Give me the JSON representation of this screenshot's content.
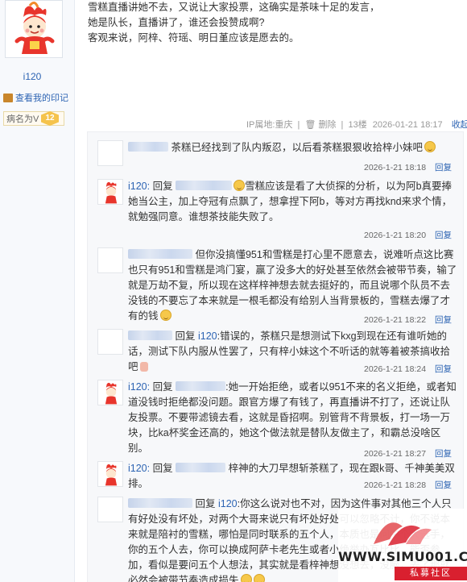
{
  "author": {
    "username": "i120",
    "imprint_link": "查看我的印记",
    "rank_title": "病名为V",
    "rank_level": "12"
  },
  "post": {
    "lines": [
      "雪糕直播讲她不去，又说让大家投票，这确实是茶味十足的发言，",
      "她是队长，直播讲了，谁还会投赞成啊?",
      "客观来说，阿梓、符瑶、明日堇应该是愿去的。"
    ],
    "ip": "IP属地:重庆",
    "delete": "删除",
    "floor": "13楼",
    "time": "2026-01-21 18:17",
    "reply_toggle": "收起回复"
  },
  "replies": [
    {
      "author_shown": "",
      "text": "茶糕已经找到了队内叛忍，以后看茶糕狠狠收拾梓小妹吧",
      "time": "2026-1-21 18:18",
      "reply_label": "回复"
    },
    {
      "author_shown": "i120:",
      "reply_prefix": "回复",
      "text": "雪糕应该是看了大侦探的分析，以为阿b真要捧她当公主，加上夺冠有点飘了，想拿捏下阿b，等对方再找knd来求个情，就勉强同意。谁想茶技能失败了。",
      "time": "2026-1-21 18:20",
      "reply_label": "回复"
    },
    {
      "author_shown": "",
      "text": "但你没搞懂951和雪糕是打心里不愿意去，说难听点这比赛也只有951和雪糕是鸿门宴，赢了没多大的好处甚至依然会被带节奏，输了就是万劫不复，所以现在这样梓神想去就去挺好的，而且说哪个队员不去没钱的不要忘了本来就是一根毛都没有给别人当背景板的，雪糕去爆了才有的钱",
      "time": "2026-1-21 18:22",
      "reply_label": "回复"
    },
    {
      "author_shown": "",
      "reply_prefix": "回复",
      "reply_target": "i120",
      "text": ":错误的，茶糕只是想测试下kxg到现在还有谁听她的话，测试下队内服从性罢了，只有梓小妹这个不听话的就等着被茶搞收拾吧",
      "time": "2026-1-21 18:24",
      "reply_label": "回复"
    },
    {
      "author_shown": "i120:",
      "reply_prefix": "回复",
      "text": ":她一开始拒绝，或者以951不来的名义拒绝，或者知道没钱时拒绝都没问题。跟官方爆了有钱了，再直播讲不打了，还说让队友投票。不要带滤镜去看，这就是昏招啊。别管背不背景板，打一场一万块，比ka杯奖金还高的，她这个做法就是替队友做主了，和霸总没啥区别。",
      "time": "2026-1-21 18:27",
      "reply_label": "回复"
    },
    {
      "author_shown": "i120:",
      "reply_prefix": "回复",
      "text": "梓神的大刀早想斩茶糕了，现在跟k哥、千神美美双排。",
      "time": "2026-1-21 18:28",
      "reply_label": "回复"
    },
    {
      "author_shown": "",
      "reply_prefix": "回复",
      "reply_target": "i120",
      "text": ":你这么说对也不对，因为这件事对其他三个人只有好处没有坏处，对两个大哥来说只有坏处好处可以忽略不计，你不说本来就是陪衬的雪糕，哪怕是同时联系的五个人，本质也是问中个大选手，你的五个人去，你可以换成阿萨卡老先生或者小绝举办瓦比比，能否参加，看似是要问五个人想法，其实就是看梓神想没想去，没脑，去了那就必然会被带节奏造成损失",
      "time": "",
      "reply_label": ""
    }
  ],
  "watermark": {
    "site": "WWW.SIMU001.CN",
    "label": "私募社区"
  }
}
